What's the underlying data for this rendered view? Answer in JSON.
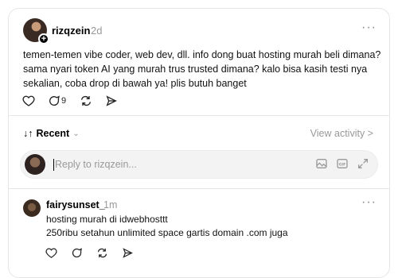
{
  "post": {
    "username": "rizqzein",
    "time": "2d",
    "text": "temen-temen vibe coder, web dev, dll. info dong buat hosting murah beli dimana? sama nyari token AI yang murah trus trusted dimana? kalo bisa kasih testi nya sekalian, coba drop di bawah ya! plis butuh banget",
    "reply_count": "9",
    "more_label": "···"
  },
  "sort": {
    "label": "Recent",
    "icon": "↓↑",
    "chevron": "⌄"
  },
  "view_activity": "View activity >",
  "reply": {
    "placeholder": "Reply to rizqzein..."
  },
  "comment": {
    "username": "fairysunset_",
    "time": "1m",
    "line1": "hosting murah di idwebhosttt",
    "line2": "250ribu setahun unlimited space gartis domain .com juga",
    "more_label": "···"
  },
  "icons": {
    "like": "heart-icon",
    "reply": "comment-icon",
    "repost": "repost-icon",
    "share": "send-icon",
    "image": "image-icon",
    "gif": "gif-icon",
    "expand": "expand-icon"
  }
}
